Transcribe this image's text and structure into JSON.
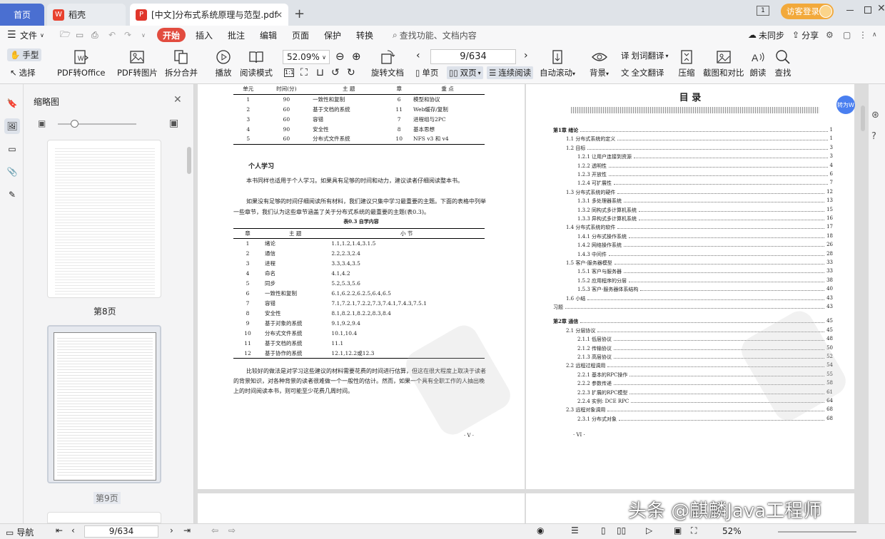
{
  "tabs": [
    {
      "label": "首页"
    },
    {
      "label": "稻壳"
    },
    {
      "label": "[中文]分布式系统原理与范型.pdf"
    }
  ],
  "window": {
    "login": "访客登录",
    "page_badge": "1"
  },
  "menu": {
    "file": "文件",
    "items": [
      "开始",
      "插入",
      "批注",
      "编辑",
      "页面",
      "保护",
      "转换"
    ],
    "search": "查找功能、文档内容",
    "sync": "未同步",
    "share": "分享"
  },
  "ribbon": {
    "hand": "手型",
    "select": "选择",
    "pdf_office": "PDF转Office",
    "pdf_image": "PDF转图片",
    "split_merge": "拆分合并",
    "play": "播放",
    "read_mode": "阅读模式",
    "zoom": "52.09%",
    "rotate": "旋转文档",
    "page_nav": "9/634",
    "single": "单页",
    "double": "双页",
    "continuous": "连续阅读",
    "autoscroll": "自动滚动",
    "background": "背景",
    "word_translate": "划词翻译",
    "full_translate": "全文翻译",
    "compress": "压缩",
    "screenshot": "截图和对比",
    "read_aloud": "朗读",
    "find": "查找"
  },
  "thumbs": {
    "title": "缩略图",
    "page8": "第8页",
    "page9": "第9页"
  },
  "left_page": {
    "top_table": [
      [
        "1",
        "90",
        "一致性和复制",
        "6",
        "模型和协议"
      ],
      [
        "2",
        "60",
        "基于文档的系统",
        "11",
        "Web缓存/复制"
      ],
      [
        "3",
        "60",
        "容错",
        "7",
        "进程组与2PC"
      ],
      [
        "4",
        "90",
        "安全性",
        "8",
        "基本思想"
      ],
      [
        "5",
        "60",
        "分布式文件系统",
        "10",
        "NFS v3 和 v4"
      ]
    ],
    "top_header": [
      "单元",
      "时间(分)",
      "主  题",
      "章",
      "重  点"
    ],
    "section_title": "个人学习",
    "para1": "本书同样也适用于个人学习。如果具有足够的时间和动力，建议读者仔细阅读整本书。",
    "para2": "如果没有足够的时间仔细阅读所有材料，我们建议只集中学习最重要的主题。下面的表格中列举一些章节，我们认为这些章节涵盖了关于分布式系统的最重要的主题(表0.3)。",
    "table_caption": "表0.3  自学内容",
    "table_header": [
      "章",
      "主  题",
      "小  节"
    ],
    "table_rows": [
      [
        "1",
        "绪论",
        "1.1,1.2,1.4,3.1.5"
      ],
      [
        "2",
        "通信",
        "2.2,2.3,2.4"
      ],
      [
        "3",
        "进程",
        "3.3,3.4,3.5"
      ],
      [
        "4",
        "命名",
        "4.1,4.2"
      ],
      [
        "5",
        "同步",
        "5.2,5.3,5.6"
      ],
      [
        "6",
        "一致性和复制",
        "6.1,6.2.2,6.2.5,6.4,6.5"
      ],
      [
        "7",
        "容错",
        "7.1,7.2.1,7.2.2,7.3,7.4.1,7.4.3,7.5.1"
      ],
      [
        "8",
        "安全性",
        "8.1,8.2.1,8.2.2,8.3,8.4"
      ],
      [
        "9",
        "基于对象的系统",
        "9.1,9.2,9.4"
      ],
      [
        "10",
        "分布式文件系统",
        "10.1,10.4"
      ],
      [
        "11",
        "基于文档的系统",
        "11.1"
      ],
      [
        "12",
        "基于协作的系统",
        "12.1,12.2或12.3"
      ]
    ],
    "para3": "比较好的做法是对学习这些建议的材料需要花费的时间进行估算，但这在很大程度上取决于读者的背景知识，对各种背景的读者很难做一个一般性的估计。然而，如果一个具有全职工作的人抽出晚上的时间阅读本书，则可能至少花费几周时间。",
    "page_no": "· V ·"
  },
  "right_page": {
    "title": "目    录",
    "page_no": "· VI ·",
    "toc": [
      {
        "num": "第1章",
        "text": "绪论",
        "page": "1",
        "lvl": 0
      },
      {
        "num": "1.1",
        "text": "分布式系统的定义",
        "page": "1",
        "lvl": 1
      },
      {
        "num": "1.2",
        "text": "目标",
        "page": "3",
        "lvl": 1
      },
      {
        "num": "1.2.1",
        "text": "让用户连接到资源",
        "page": "3",
        "lvl": 2
      },
      {
        "num": "1.2.2",
        "text": "透明性",
        "page": "4",
        "lvl": 2
      },
      {
        "num": "1.2.3",
        "text": "开放性",
        "page": "6",
        "lvl": 2
      },
      {
        "num": "1.2.4",
        "text": "可扩展性",
        "page": "7",
        "lvl": 2
      },
      {
        "num": "1.3",
        "text": "分布式系统的硬件",
        "page": "12",
        "lvl": 1
      },
      {
        "num": "1.3.1",
        "text": "多处理器系统",
        "page": "13",
        "lvl": 2
      },
      {
        "num": "1.3.2",
        "text": "同构式多计算机系统",
        "page": "15",
        "lvl": 2
      },
      {
        "num": "1.3.3",
        "text": "异构式多计算机系统",
        "page": "16",
        "lvl": 2
      },
      {
        "num": "1.4",
        "text": "分布式系统的软件",
        "page": "17",
        "lvl": 1
      },
      {
        "num": "1.4.1",
        "text": "分布式操作系统",
        "page": "18",
        "lvl": 2
      },
      {
        "num": "1.4.2",
        "text": "网络操作系统",
        "page": "26",
        "lvl": 2
      },
      {
        "num": "1.4.3",
        "text": "中间件",
        "page": "28",
        "lvl": 2
      },
      {
        "num": "1.5",
        "text": "客户-服务器模型",
        "page": "33",
        "lvl": 1
      },
      {
        "num": "1.5.1",
        "text": "客户与服务器",
        "page": "33",
        "lvl": 2
      },
      {
        "num": "1.5.2",
        "text": "应用程序的分层",
        "page": "38",
        "lvl": 2
      },
      {
        "num": "1.5.3",
        "text": "客户-服务器体系结构",
        "page": "40",
        "lvl": 2
      },
      {
        "num": "1.6",
        "text": "小结",
        "page": "43",
        "lvl": 1
      },
      {
        "num": "",
        "text": "习题",
        "page": "43",
        "lvl": 0
      },
      {
        "num": "第2章",
        "text": "通信",
        "page": "45",
        "lvl": 0
      },
      {
        "num": "2.1",
        "text": "分层协议",
        "page": "45",
        "lvl": 1
      },
      {
        "num": "2.1.1",
        "text": "低层协议",
        "page": "48",
        "lvl": 2
      },
      {
        "num": "2.1.2",
        "text": "传输协议",
        "page": "50",
        "lvl": 2
      },
      {
        "num": "2.1.3",
        "text": "高层协议",
        "page": "52",
        "lvl": 2
      },
      {
        "num": "2.2",
        "text": "远程过程调用",
        "page": "54",
        "lvl": 1
      },
      {
        "num": "2.2.1",
        "text": "基本的RPC操作",
        "page": "55",
        "lvl": 2
      },
      {
        "num": "2.2.2",
        "text": "参数传递",
        "page": "58",
        "lvl": 2
      },
      {
        "num": "2.2.3",
        "text": "扩展的RPC模型",
        "page": "61",
        "lvl": 2
      },
      {
        "num": "2.2.4",
        "text": "实例: DCE RPC",
        "page": "64",
        "lvl": 2
      },
      {
        "num": "2.3",
        "text": "远程对象调用",
        "page": "68",
        "lvl": 1
      },
      {
        "num": "2.3.1",
        "text": "分布式对象",
        "page": "68",
        "lvl": 2
      }
    ]
  },
  "side_button": "转为W",
  "status": {
    "nav": "导航",
    "page": "9/634",
    "zoom": "52%"
  },
  "watermark": "头条 @麒麟Java工程师"
}
